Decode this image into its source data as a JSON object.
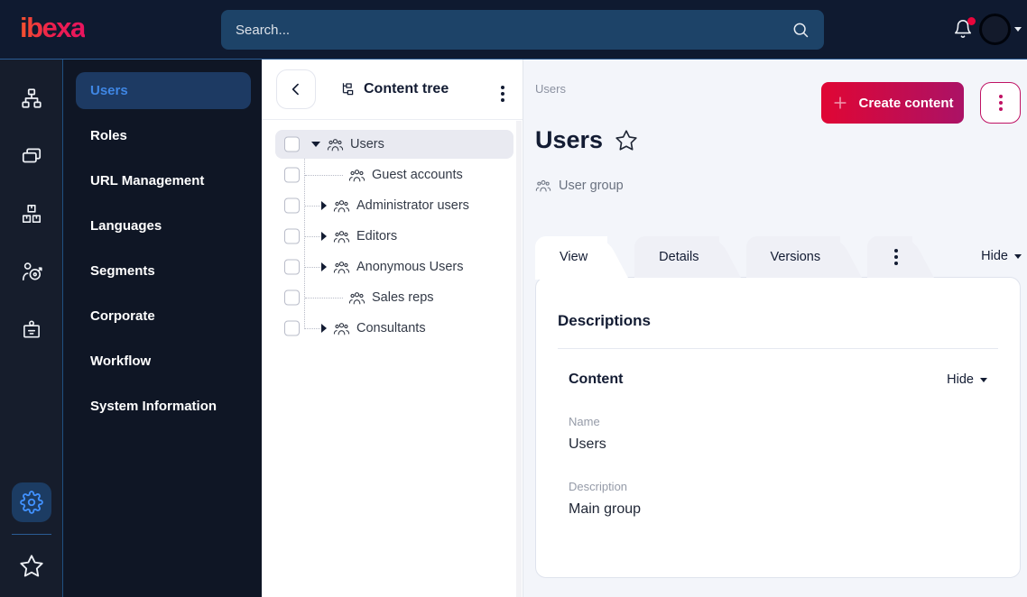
{
  "topbar": {
    "logo_text": "ibexa",
    "search_placeholder": "Search..."
  },
  "sidebar": {
    "items": [
      {
        "label": "Users"
      },
      {
        "label": "Roles"
      },
      {
        "label": "URL Management"
      },
      {
        "label": "Languages"
      },
      {
        "label": "Segments"
      },
      {
        "label": "Corporate"
      },
      {
        "label": "Workflow"
      },
      {
        "label": "System Information"
      }
    ]
  },
  "content_tree": {
    "title": "Content tree",
    "items": [
      {
        "label": "Users"
      },
      {
        "label": "Guest accounts"
      },
      {
        "label": "Administrator users"
      },
      {
        "label": "Editors"
      },
      {
        "label": "Anonymous Users"
      },
      {
        "label": "Sales reps"
      },
      {
        "label": "Consultants"
      }
    ]
  },
  "main": {
    "breadcrumb": "Users",
    "create_button_label": "Create content",
    "page_title": "Users",
    "content_type": "User group",
    "tabs": [
      {
        "label": "View"
      },
      {
        "label": "Details"
      },
      {
        "label": "Versions"
      }
    ],
    "hide_toggle": "Hide",
    "card": {
      "heading": "Descriptions",
      "section_title": "Content",
      "section_toggle": "Hide",
      "fields": [
        {
          "label": "Name",
          "value": "Users"
        },
        {
          "label": "Description",
          "value": "Main group"
        }
      ]
    }
  },
  "colors": {
    "primary_gradient_start": "#e00634",
    "primary_gradient_end": "#ab1266",
    "accent_blue": "#3f87e5",
    "topbar_bg": "#0f1a30",
    "sidebar_bg": "#0f1625"
  }
}
